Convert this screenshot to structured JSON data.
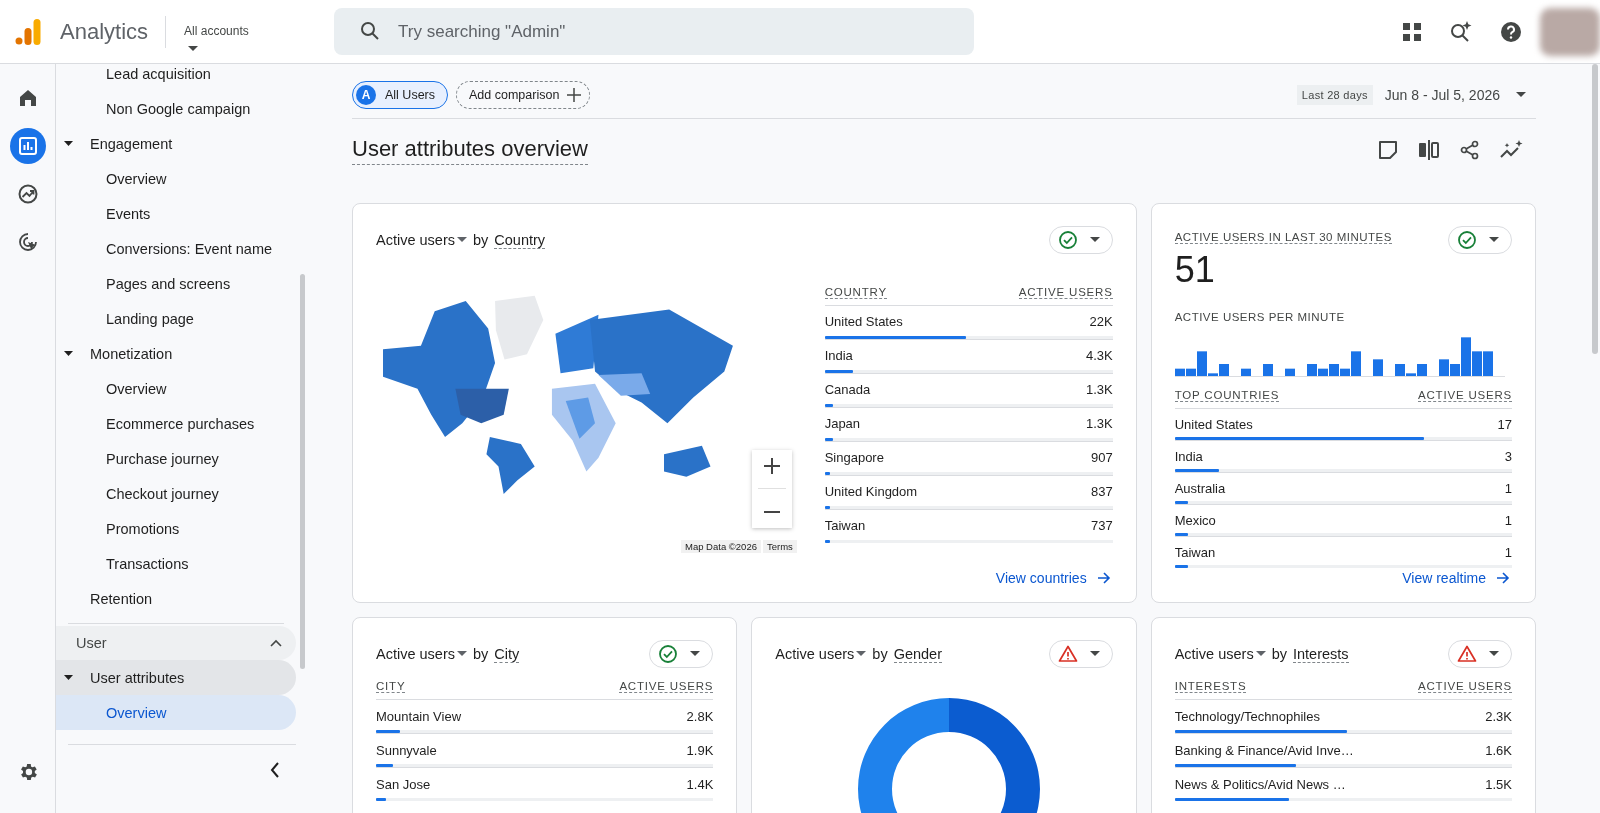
{
  "header": {
    "product": "Analytics",
    "account_label": "All accounts",
    "search": {
      "placeholder": "Try searching \"Admin\""
    }
  },
  "rail": [
    {
      "selected": false
    },
    {
      "selected": true
    },
    {
      "selected": false
    },
    {
      "selected": false
    }
  ],
  "sidebar": {
    "sections": [
      {
        "items": [
          {
            "children": [
              {
                "label": "Lead acquisition",
                "selected": false
              },
              {
                "label": "Non Google campaign",
                "selected": false
              }
            ]
          },
          {
            "label": "Engagement",
            "expanded": true,
            "selected": false,
            "children": [
              {
                "label": "Overview",
                "selected": false
              },
              {
                "label": "Events",
                "selected": false
              },
              {
                "label": "Conversions: Event name",
                "selected": false
              },
              {
                "label": "Pages and screens",
                "selected": false
              },
              {
                "label": "Landing page",
                "selected": false
              }
            ]
          },
          {
            "label": "Monetization",
            "expanded": true,
            "selected": false,
            "children": [
              {
                "label": "Overview",
                "selected": false
              },
              {
                "label": "Ecommerce purchases",
                "selected": false
              },
              {
                "label": "Purchase journey",
                "selected": false
              },
              {
                "label": "Checkout journey",
                "selected": false
              },
              {
                "label": "Promotions",
                "selected": false
              },
              {
                "label": "Transactions",
                "selected": false
              }
            ]
          },
          {
            "label": "Retention",
            "selected": false
          }
        ]
      },
      {
        "title": "User",
        "expanded": true,
        "items": [
          {
            "label": "User attributes",
            "expanded": true,
            "selected": false,
            "children": [
              {
                "label": "Overview",
                "selected": true
              }
            ]
          }
        ]
      }
    ]
  },
  "comparison": {
    "segments": [
      {
        "letter": "A",
        "label": "All Users"
      }
    ],
    "add_label": "Add comparison"
  },
  "date_range": {
    "preset": "Last 28 days",
    "range": "Jun 8 - Jul 5, 2026"
  },
  "page_title": "User attributes overview",
  "cards": [
    {
      "kind": "map",
      "metric": "Active users",
      "by": "by",
      "dimension": "Country",
      "warning": false,
      "columns": [
        "COUNTRY",
        "ACTIVE USERS"
      ],
      "rows": [
        {
          "name": "United States",
          "value": "22K",
          "level": 0.49
        },
        {
          "name": "India",
          "value": "4.3K",
          "level": 0.1
        },
        {
          "name": "Canada",
          "value": "1.3K",
          "level": 0.03
        },
        {
          "name": "Japan",
          "value": "1.3K",
          "level": 0.03
        },
        {
          "name": "Singapore",
          "value": "907",
          "level": 0.02
        },
        {
          "name": "United Kingdom",
          "value": "837",
          "level": 0.02
        },
        {
          "name": "Taiwan",
          "value": "737",
          "level": 0.02
        }
      ],
      "map_credit": "Map Data ©2026",
      "map_terms": "Terms",
      "link": "View countries"
    },
    {
      "kind": "realtime",
      "title": "ACTIVE USERS IN LAST 30 MINUTES",
      "value": "51",
      "chart_label": "ACTIVE USERS PER MINUTE",
      "warning": false,
      "columns": [
        "TOP COUNTRIES",
        "ACTIVE USERS"
      ],
      "rows": [
        {
          "name": "United States",
          "value": "17",
          "level": 0.74
        },
        {
          "name": "India",
          "value": "3",
          "level": 0.13
        },
        {
          "name": "Australia",
          "value": "1",
          "level": 0.04
        },
        {
          "name": "Mexico",
          "value": "1",
          "level": 0.04
        },
        {
          "name": "Taiwan",
          "value": "1",
          "level": 0.04
        }
      ],
      "link": "View realtime"
    },
    {
      "kind": "table",
      "metric": "Active users",
      "by": "by",
      "dimension": "City",
      "warning": false,
      "columns": [
        "CITY",
        "ACTIVE USERS"
      ],
      "rows": [
        {
          "name": "Mountain View",
          "value": "2.8K",
          "level": 0.07
        },
        {
          "name": "Sunnyvale",
          "value": "1.9K",
          "level": 0.05
        },
        {
          "name": "San Jose",
          "value": "1.4K",
          "level": 0.03
        }
      ]
    },
    {
      "kind": "donut",
      "metric": "Active users",
      "by": "by",
      "dimension": "Gender",
      "warning": true
    },
    {
      "kind": "table",
      "metric": "Active users",
      "by": "by",
      "dimension": "Interests",
      "warning": true,
      "columns": [
        "INTERESTS",
        "ACTIVE USERS"
      ],
      "rows": [
        {
          "name": "Technology/Technophiles",
          "value": "2.3K",
          "level": 0.51
        },
        {
          "name": "Banking & Finance/Avid Inve…",
          "value": "1.6K",
          "level": 0.36
        },
        {
          "name": "News & Politics/Avid News …",
          "value": "1.5K",
          "level": 0.34
        }
      ]
    }
  ]
}
